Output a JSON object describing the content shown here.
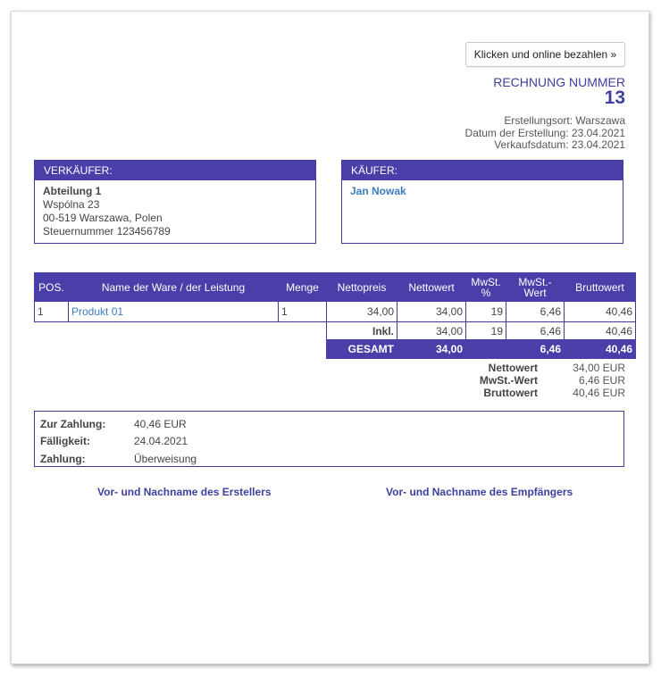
{
  "pay_button": "Klicken und online bezahlen »",
  "invoice": {
    "title": "RECHNUNG NUMMER",
    "number": "13",
    "place": "Erstellungsort: Warszawa",
    "created": "Datum der Erstellung: 23.04.2021",
    "sale_date": "Verkaufsdatum: 23.04.2021"
  },
  "seller": {
    "header": "VERKÄUFER:",
    "name": "Abteilung 1",
    "street": "Wspólna 23",
    "city": "00-519 Warszawa, Polen",
    "tax": "Steuernummer 123456789"
  },
  "buyer": {
    "header": "KÄUFER:",
    "name": "Jan Nowak"
  },
  "table": {
    "headers": {
      "pos": "POS.",
      "name": "Name der Ware / der Leistung",
      "qty": "Menge",
      "net_price": "Nettopreis",
      "net_value": "Nettowert",
      "vat_pct_1": "MwSt.",
      "vat_pct_2": "%",
      "vat_val_1": "MwSt.-",
      "vat_val_2": "Wert",
      "gross": "Bruttowert"
    },
    "rows": [
      {
        "pos": "1",
        "name": "Produkt 01",
        "qty": "1",
        "net_price": "34,00",
        "net_value": "34,00",
        "vat_pct": "19",
        "vat_value": "6,46",
        "gross": "40,46"
      }
    ],
    "inkl": {
      "label": "Inkl.",
      "net_value": "34,00",
      "vat_pct": "19",
      "vat_value": "6,46",
      "gross": "40,46"
    },
    "total": {
      "label": "GESAMT",
      "net_value": "34,00",
      "vat_value": "6,46",
      "gross": "40,46"
    }
  },
  "totals": [
    {
      "label": "Nettowert",
      "value": "34,00 EUR"
    },
    {
      "label": "MwSt.-Wert",
      "value": "6,46 EUR"
    },
    {
      "label": "Bruttowert",
      "value": "40,46 EUR"
    }
  ],
  "payment": {
    "due_label": "Zur Zahlung:",
    "due_value": "40,46 EUR",
    "deadline_label": "Fälligkeit:",
    "deadline_value": "24.04.2021",
    "method_label": "Zahlung:",
    "method_value": "Überweisung"
  },
  "signatures": {
    "issuer": "Vor- und Nachname des Erstellers",
    "recipient": "Vor- und Nachname des Empfängers"
  },
  "colors": {
    "accent": "#4a3ea8",
    "title": "#3f3f9f",
    "link": "#3e7bbf"
  }
}
